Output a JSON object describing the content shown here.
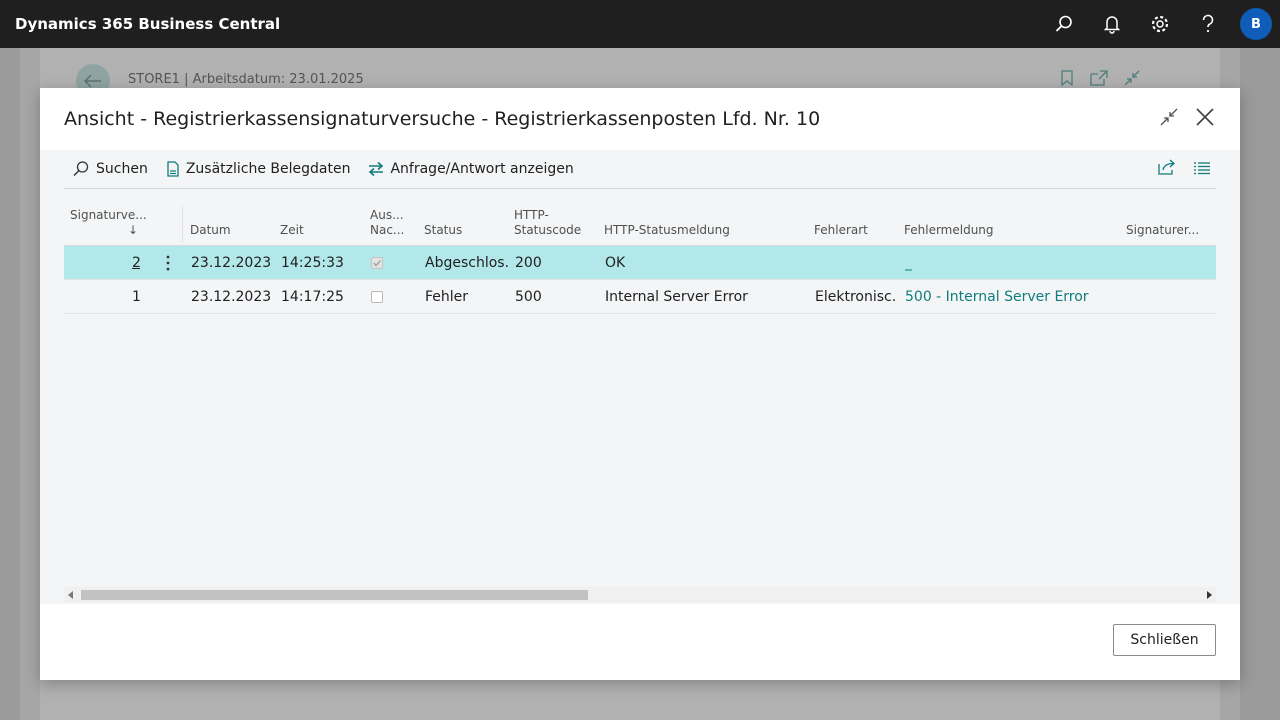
{
  "app": {
    "title": "Dynamics 365 Business Central",
    "user_initial": "B"
  },
  "background": {
    "breadcrumb": "STORE1 | Arbeitsdatum: 23.01.2025"
  },
  "dialog": {
    "title": "Ansicht - Registrierkassensignaturversuche - Registrierkassenposten Lfd. Nr. 10",
    "actions": {
      "search": "Suchen",
      "additional_docs": "Zusätzliche Belegdaten",
      "show_request": "Anfrage/Antwort anzeigen"
    },
    "columns": {
      "signature_line1": "Signaturve...",
      "sort_arrow": "↓",
      "date": "Datum",
      "time": "Zeit",
      "aus_line1": "Aus...",
      "aus_line2": "Nac...",
      "status": "Status",
      "http_line1": "HTTP-",
      "http_line2": "Statuscode",
      "http_msg": "HTTP-Statusmeldung",
      "error_type": "Fehlerart",
      "error_msg": "Fehlermeldung",
      "signer": "Signaturer..."
    },
    "rows": [
      {
        "nr": "2",
        "date": "23.12.2023",
        "time": "14:25:33",
        "checked": true,
        "status": "Abgeschlos...",
        "code": "200",
        "msg": "OK",
        "error_type": "",
        "error_msg": "_",
        "signer": ""
      },
      {
        "nr": "1",
        "date": "23.12.2023",
        "time": "14:17:25",
        "checked": false,
        "status": "Fehler",
        "code": "500",
        "msg": "Internal Server Error",
        "error_type": "Elektronisc...",
        "error_msg": "500 - Internal Server Error",
        "signer": ""
      }
    ],
    "close_label": "Schließen"
  }
}
